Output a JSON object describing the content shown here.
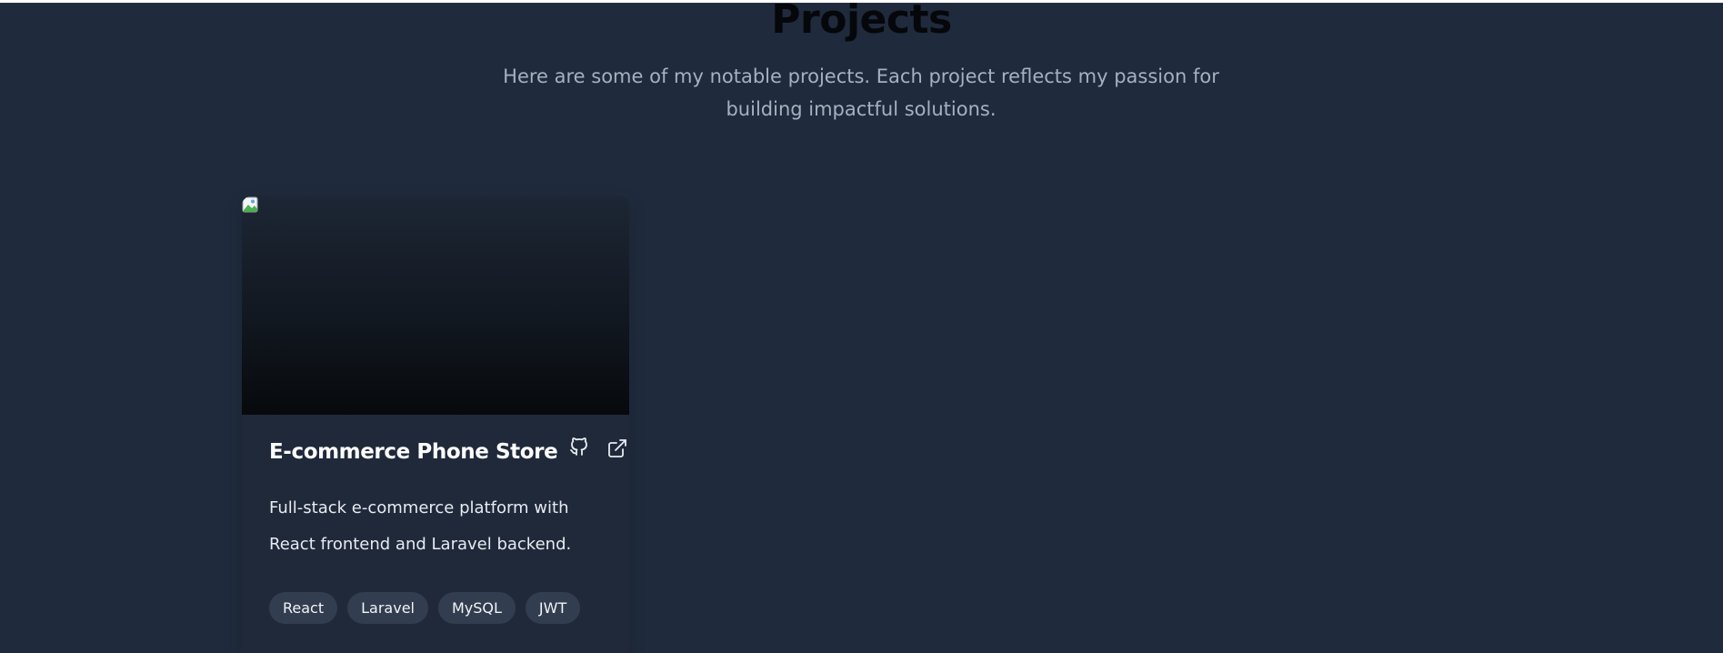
{
  "section": {
    "title": "Projects",
    "subtitle": "Here are some of my notable projects. Each project reflects my passion for building impactful solutions."
  },
  "projects": [
    {
      "title": "E-commerce Phone Store",
      "description": "Full-stack e-commerce platform with React frontend and Laravel backend.",
      "image_alt": "",
      "icons": {
        "github": "github-icon",
        "external": "external-link-icon"
      },
      "tags": [
        "React",
        "Laravel",
        "MySQL",
        "JWT"
      ]
    }
  ],
  "colors": {
    "background": "#1f2a3c",
    "card": "#1f293a",
    "tag_bg": "#323d4f",
    "title": "#05070b",
    "subtitle": "#a7b0bf"
  }
}
